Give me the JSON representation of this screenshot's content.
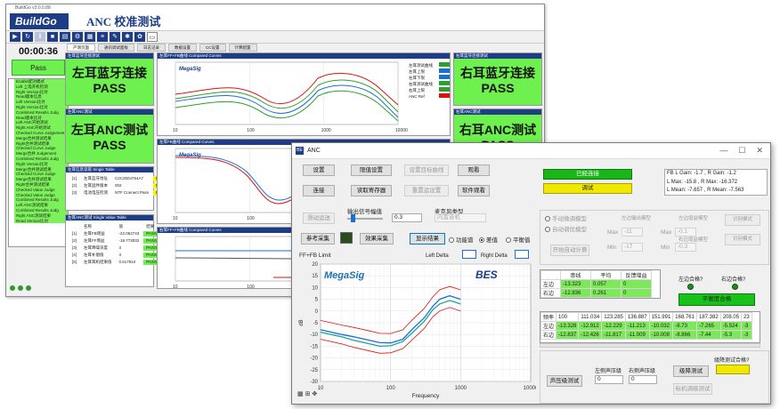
{
  "bg_app": {
    "window_title": "BuildGo v3.0.0.88",
    "logo": "BuildGo",
    "app_title": "ANC 校准测试",
    "subtabs": [
      "产测页面",
      "通讯调试面板",
      "日志记录",
      "数据设置",
      "CC设置",
      "计算配置"
    ],
    "timer": "00:00:36",
    "pass_label": "Pass",
    "steps": [
      "Enable配对模式",
      "Left 上电开机检测",
      "Right Version比对",
      "Read版本信息",
      "Left Version比对",
      "Right Version比对",
      "Combined Results Judg",
      "Read版本比对",
      "Left ANC开始测试",
      "Right ANC开始测试",
      "Checked Curve Judgement",
      "Merge合并测试结果",
      "Right合并测试结果",
      "Checked Curve Judge",
      "Merge合并 Judgement",
      "Combined Results Judg",
      "Right Version比对",
      "Merge合并测试结果",
      "Checked Curve Judge",
      "Merge合并测试结果",
      "Right合并测试结果",
      "Checked Value Judge",
      "Checked Value Judge",
      "Combined Results Judg",
      "Left ANC测试结果",
      "Combined Results Judg",
      "Right ANC测试结果",
      "Read Version比对"
    ],
    "panel_left_bt_title": "左耳蓝牙连接测试",
    "left_bt": "左耳蓝牙连接",
    "left_bt_pass": "PASS",
    "panel_left_anc_title": "左耳ANC测试",
    "left_anc": "左耳ANC测试",
    "left_anc_pass": "PASS",
    "panel_right_bt_title": "右耳蓝牙连接测试",
    "right_bt": "右耳蓝牙连接",
    "right_bt_pass": "PASS",
    "panel_right_anc_title": "右耳ANC测试",
    "right_anc": "右耳ANC测试",
    "right_anc_pass": "PASS",
    "table1_title": "左耳信息读取 Single Table",
    "table1_rows": [
      [
        "[1]",
        "左耳蓝牙地址",
        "C2C2504754A7",
        "Run OK"
      ],
      [
        "[2]",
        "左耳固件版本",
        "002",
        "Run OK"
      ],
      [
        "[3]",
        "电池电压检测",
        "NTF Connect Pass",
        "Run OK"
      ]
    ],
    "table2_title": "左耳ANC测试 Single Value Table",
    "table2_head": [
      "",
      "名称",
      "值",
      "结果"
    ],
    "table2_rows": [
      [
        "[1]",
        "左耳FB增益",
        "-22.052743",
        "PASS"
      ],
      [
        "[2]",
        "左耳FF增益",
        "-18.773032",
        "PASS"
      ],
      [
        "[3]",
        "左耳降噪深度",
        "3",
        "PASS"
      ],
      [
        "[4]",
        "左耳补偿值",
        "3",
        "PASS"
      ],
      [
        "[5]",
        "左耳耳机结果值",
        "0.517910",
        "PASS"
      ]
    ],
    "curve1_title": "左耳FF+FB曲线 Compared Curves",
    "curve1_logo": "MegaSig",
    "curve2_title": "左耳FB曲线 Compared Curves",
    "curve2_logo": "MegaSig",
    "curve3_title": "右耳FF+FB曲线 Compared Curves",
    "legend_items": [
      "左耳测试曲线",
      "左耳上限",
      "左耳下限",
      "右耳测试曲线",
      "右耳上限",
      "ANC Ref"
    ],
    "freq_ticks": [
      "10",
      "100",
      "1000",
      "10000"
    ]
  },
  "dlg": {
    "title": "ANC",
    "buttons_row1": [
      "设置",
      "限值设置",
      "设置目标曲线",
      "观看"
    ],
    "buttons_row2": [
      "连接",
      "读取寄存器",
      "重置运设置",
      "软件观看"
    ],
    "pause_btn": "滑动运送",
    "out_level_label": "输出信号幅值",
    "out_level_value": "0.3",
    "mic_type_label": "麦克风类型",
    "mic_type_value": "内置音机",
    "btn_ref": "参考采集",
    "btn_noise": "效果采集",
    "btn_show": "显示结果",
    "radio_opts": [
      "功能谱",
      "差值",
      "平衡值"
    ],
    "radio_selected": 1,
    "top_status": "已经连接",
    "yellow_status": "调试",
    "gain_info": [
      "FB L Gain: -1.7 , R Gain: -1.2",
      "L Max: -15.8 , R Max: -16.372",
      "L Mean: -7.657 , R Mean: -7.563"
    ],
    "radio_manual": "手动微调模型",
    "radio_auto": "自动调优模型",
    "set_params": "开始自动计算",
    "cell_left_title": "左边输出模型",
    "cell_mid_title": "左边增益模型",
    "cell_right_title": "右边增益模型",
    "mode_btn": "识别模式",
    "max_label": "Max",
    "max_l": "-11",
    "max_r": "-0.1",
    "min_label": "Min",
    "min_l": "-17",
    "min_r": "-0.3",
    "chart_title": "FF+FB Limit",
    "chart_logo": "MegaSig",
    "chart_brand": "BES",
    "legend_left": "Left Delta",
    "legend_right": "Right Delta",
    "chart": {
      "chart_data": {
        "type": "line",
        "title": "FF+FB Limit",
        "xlabel": "Frequency",
        "ylabel": "dB",
        "xscale": "log",
        "xlim": [
          10,
          10000
        ],
        "ylim": [
          -30,
          20
        ],
        "xticks": [
          "10",
          "100",
          "1000",
          "10000"
        ],
        "yticks": [
          "20",
          "15",
          "10",
          "5",
          "0",
          "-5",
          "-10",
          "-15",
          "-20",
          "-25",
          "-30"
        ],
        "series": [
          {
            "name": "Left Delta",
            "x": [
              10,
              20,
              30,
              50,
              70,
              100,
              150,
              200,
              300,
              400,
              500,
              700,
              1000
            ],
            "y": [
              -8,
              -10,
              -11,
              -12.5,
              -13.5,
              -13.6,
              -12,
              -8,
              -3,
              2,
              5,
              6.5,
              5
            ]
          },
          {
            "name": "Right Delta",
            "x": [
              10,
              20,
              30,
              50,
              70,
              100,
              150,
              200,
              300,
              400,
              500,
              700,
              1000
            ],
            "y": [
              -9,
              -11,
              -12.5,
              -14,
              -15,
              -14.8,
              -13,
              -9.5,
              -4.5,
              0.5,
              3,
              4.5,
              3
            ]
          }
        ]
      }
    },
    "cfg_head": [
      "串线",
      "平均",
      "反馈增益"
    ],
    "cfg_rows": [
      [
        "左边",
        "-13.323",
        "0.057",
        "0"
      ],
      [
        "右边",
        "-12.836",
        "0.261",
        "0"
      ]
    ],
    "left_anc_label": "左边合格?",
    "right_anc_label": "右边合格?",
    "balance_btn": "平衡度合格",
    "freq_head": [
      "频率",
      "100",
      "111.034",
      "123.285",
      "136.887",
      "151.991",
      "168.761",
      "187.382",
      "208.05",
      "23"
    ],
    "freq_rows": [
      [
        "左边",
        "-13.328",
        "-12.912",
        "-12.229",
        "-11.213",
        "-10.032",
        "-8.73",
        "-7.265",
        "-5.524",
        "-3"
      ],
      [
        "右边",
        "-12.837",
        "-12.426",
        "-11.817",
        "-11.009",
        "-10.008",
        "-8.866",
        "-7.44",
        "-5.3",
        "-3"
      ]
    ],
    "sound_test_btn": "声压级测试",
    "left_spl_label": "左侧声压级",
    "right_spl_label": "右侧声压级",
    "left_spl": "0",
    "right_spl": "0",
    "all_pass_label": "级降测试合格?",
    "sweep_btn": "级降测试",
    "sweep_btn2": "标机调级测试"
  }
}
